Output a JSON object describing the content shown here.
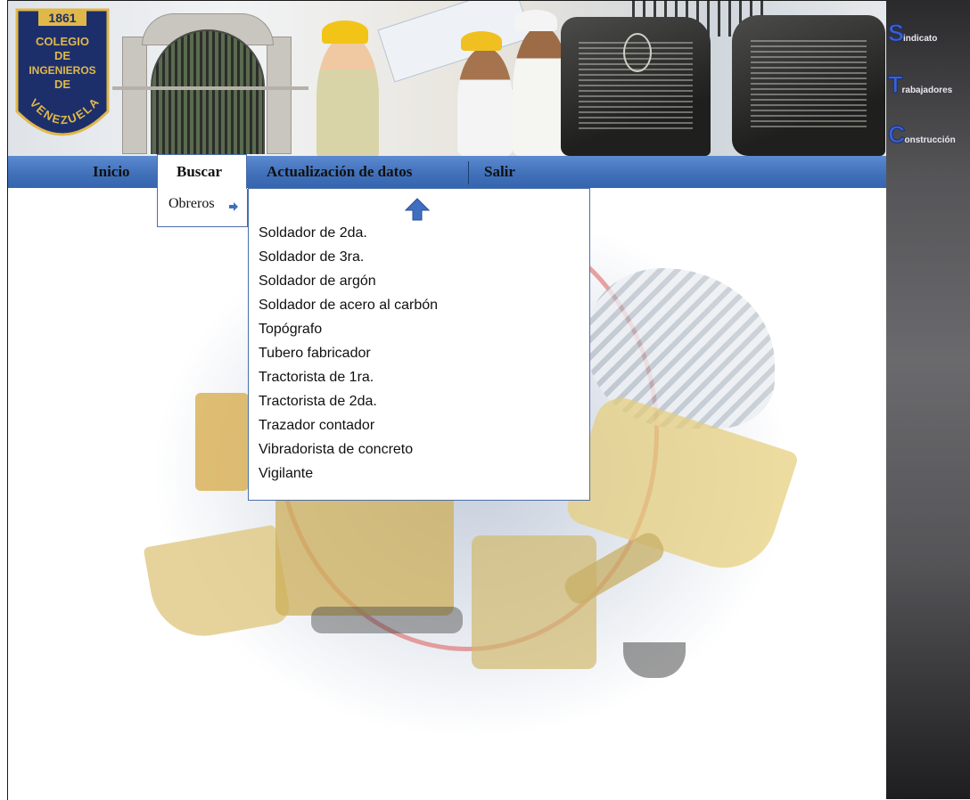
{
  "header": {
    "logo": {
      "year": "1861",
      "lines": [
        "COLEGIO",
        "DE",
        "INGENIEROS",
        "DE"
      ],
      "arc": "VENEZUELA"
    }
  },
  "nav": {
    "items": [
      {
        "label": "Inicio"
      },
      {
        "label": "Buscar"
      },
      {
        "label": "Actualización de datos"
      },
      {
        "label": "Salir"
      }
    ]
  },
  "submenu": {
    "obreros_label": "Obreros",
    "arrow_icon": "right-arrow-icon"
  },
  "dropdown": {
    "scroll_up_icon": "up-arrow-icon",
    "items": [
      "Soldador de 2da.",
      "Soldador de 3ra.",
      "Soldador de argón",
      "Soldador de acero al carbón",
      "Topógrafo",
      "Tubero fabricador",
      "Tractorista de 1ra.",
      "Tractorista de 2da.",
      "Trazador contador",
      "Vibradorista de concreto",
      "Vigilante"
    ]
  },
  "sidebar": {
    "words": [
      {
        "initial": "S",
        "rest": "indicato"
      },
      {
        "initial": "T",
        "rest": "rabajadores"
      },
      {
        "initial": "C",
        "rest": "onstrucción"
      }
    ]
  },
  "colors": {
    "nav_blue": "#3f6fb8",
    "menu_border": "#4a6fa8",
    "arrow_blue": "#3f6fc0",
    "logo_navy": "#1d2f6b",
    "logo_gold": "#e0b84a"
  }
}
